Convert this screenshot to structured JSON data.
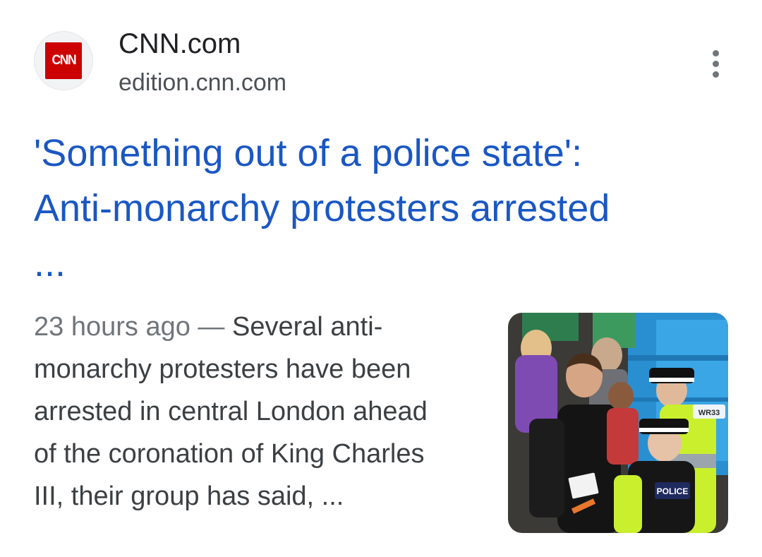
{
  "source": {
    "name": "CNN.com",
    "domain": "edition.cnn.com",
    "favicon_text": "CNN",
    "favicon_color": "#cc0000"
  },
  "headline": {
    "line1": "'Something out of a police state':",
    "line2": "Anti-monarchy protesters arrested",
    "line3": "...",
    "color": "#1a57c4"
  },
  "snippet": {
    "date": "23 hours ago",
    "separator": " — ",
    "line1_rest": "Several anti-",
    "line2": "monarchy protesters have been",
    "line3": "arrested in central London ahead",
    "line4": "of the coronation of King Charles",
    "line5": "III, their group has said, ..."
  },
  "thumbnail": {
    "vest_text": "POLICE",
    "tank_text": "WR33"
  },
  "icons": {
    "more": "more-vert-icon"
  }
}
